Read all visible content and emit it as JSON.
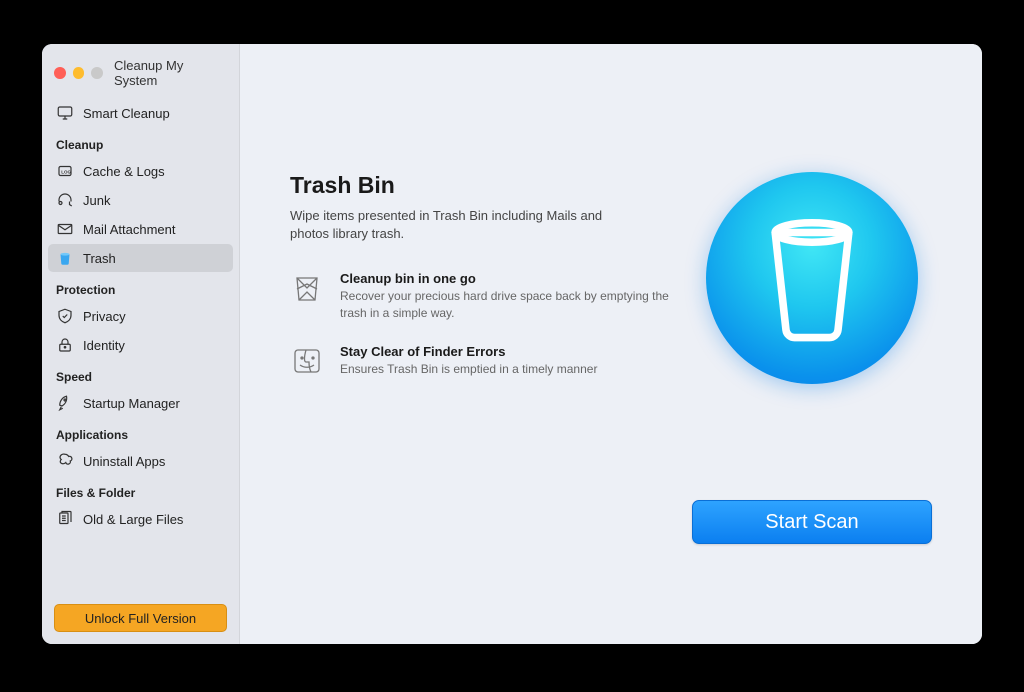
{
  "window": {
    "title": "Cleanup My System"
  },
  "sidebar": {
    "smart": {
      "label": "Smart Cleanup"
    },
    "sections": [
      {
        "label": "Cleanup",
        "items": [
          {
            "id": "cache",
            "label": "Cache & Logs",
            "icon": "log-icon"
          },
          {
            "id": "junk",
            "label": "Junk",
            "icon": "headphones-icon"
          },
          {
            "id": "mail",
            "label": "Mail Attachment",
            "icon": "envelope-icon"
          },
          {
            "id": "trash",
            "label": "Trash",
            "icon": "trash-icon",
            "selected": true
          }
        ]
      },
      {
        "label": "Protection",
        "items": [
          {
            "id": "privacy",
            "label": "Privacy",
            "icon": "shield-icon"
          },
          {
            "id": "identity",
            "label": "Identity",
            "icon": "lock-icon"
          }
        ]
      },
      {
        "label": "Speed",
        "items": [
          {
            "id": "startup",
            "label": "Startup Manager",
            "icon": "rocket-icon"
          }
        ]
      },
      {
        "label": "Applications",
        "items": [
          {
            "id": "uninstall",
            "label": "Uninstall Apps",
            "icon": "app-icon"
          }
        ]
      },
      {
        "label": "Files & Folder",
        "items": [
          {
            "id": "oldlarge",
            "label": "Old & Large Files",
            "icon": "files-icon"
          }
        ]
      }
    ],
    "unlock_label": "Unlock Full Version"
  },
  "main": {
    "title": "Trash Bin",
    "subtitle": "Wipe items presented in Trash Bin including Mails and photos library trash.",
    "features": [
      {
        "title": "Cleanup bin in one go",
        "desc": "Recover your precious hard drive space back by emptying the trash in a simple way."
      },
      {
        "title": "Stay Clear of Finder Errors",
        "desc": "Ensures Trash Bin is emptied in a timely manner"
      }
    ],
    "scan_label": "Start Scan"
  }
}
